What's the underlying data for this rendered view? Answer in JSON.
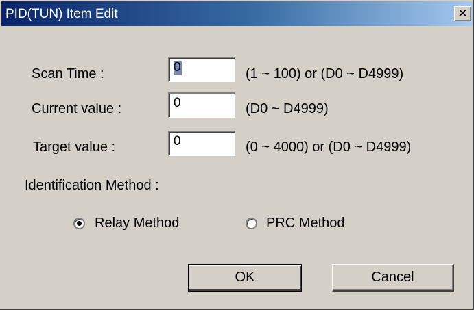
{
  "window": {
    "title": "PID(TUN) Item Edit",
    "close_glyph": "✕"
  },
  "fields": {
    "scan_time": {
      "label": "Scan Time :",
      "value": "0",
      "range": "(1 ~ 100) or (D0 ~ D4999)"
    },
    "current_value": {
      "label": "Current value :",
      "value": "0",
      "range": "(D0 ~ D4999)"
    },
    "target_value": {
      "label": "Target value :",
      "value": "0",
      "range": "(0 ~ 4000) or (D0 ~ D4999)"
    }
  },
  "identification": {
    "label": "Identification Method :",
    "options": [
      {
        "label": "Relay Method",
        "selected": true
      },
      {
        "label": "PRC Method",
        "selected": false
      }
    ]
  },
  "buttons": {
    "ok": "OK",
    "cancel": "Cancel"
  }
}
